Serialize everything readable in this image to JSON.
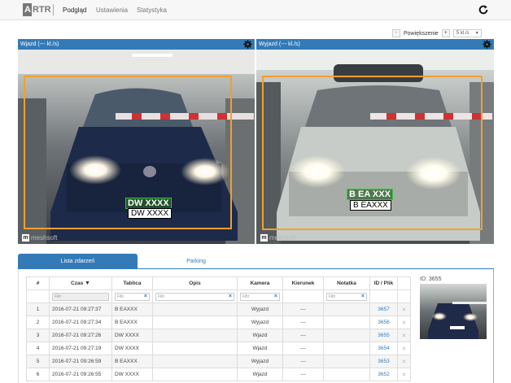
{
  "navbar": {
    "logo_box": "A",
    "logo_text": "RTR",
    "items": [
      {
        "label": "Podgląd",
        "active": true
      },
      {
        "label": "Ustawienia",
        "active": false
      },
      {
        "label": "Statystyka",
        "active": false
      }
    ]
  },
  "zoom": {
    "minus": "-",
    "label": "Powiększenie",
    "plus": "+",
    "fps": "5 kl./s"
  },
  "cameras": [
    {
      "title": "Wjazd (--- kl./s)",
      "plate_detected": "DW XXXX",
      "plate_text": "DW XXXX",
      "watermark": "meshsoft"
    },
    {
      "title": "Wyjazd (--- kl./s)",
      "plate_detected": "B EA XXX",
      "plate_text": "B EAXXX",
      "watermark": "meshsoft"
    }
  ],
  "tabs": {
    "events": "Lista zdarzeń",
    "parking": "Parking"
  },
  "table": {
    "headers": [
      "#",
      "Czas",
      "Tablica",
      "Opis",
      "Kamera",
      "Kierunek",
      "Notatka",
      "ID / Plik"
    ],
    "filter_placeholder": "Filtr",
    "rows": [
      {
        "n": "1",
        "time": "2016-07-21 09:27:37",
        "plate": "B EAXXX",
        "desc": "",
        "camera": "Wyjazd",
        "dir": "---",
        "note": "",
        "id": "3657"
      },
      {
        "n": "2",
        "time": "2016-07-21 09:27:34",
        "plate": "B EAXXX",
        "desc": "",
        "camera": "Wyjazd",
        "dir": "---",
        "note": "",
        "id": "3656"
      },
      {
        "n": "3",
        "time": "2016-07-21 09:27:26",
        "plate": "DW XXXX",
        "desc": "",
        "camera": "Wjazd",
        "dir": "---",
        "note": "",
        "id": "3655"
      },
      {
        "n": "4",
        "time": "2016-07-21 09:27:19",
        "plate": "DW XXXX",
        "desc": "",
        "camera": "Wjazd",
        "dir": "---",
        "note": "",
        "id": "3654"
      },
      {
        "n": "5",
        "time": "2016-07-21 09:26:59",
        "plate": "B EAXXX",
        "desc": "",
        "camera": "Wyjazd",
        "dir": "---",
        "note": "",
        "id": "3653"
      },
      {
        "n": "6",
        "time": "2016-07-21 09:26:55",
        "plate": "DW XXXX",
        "desc": "",
        "camera": "Wjazd",
        "dir": "---",
        "note": "",
        "id": "3652"
      }
    ]
  },
  "preview": {
    "label": "ID: 3655"
  }
}
